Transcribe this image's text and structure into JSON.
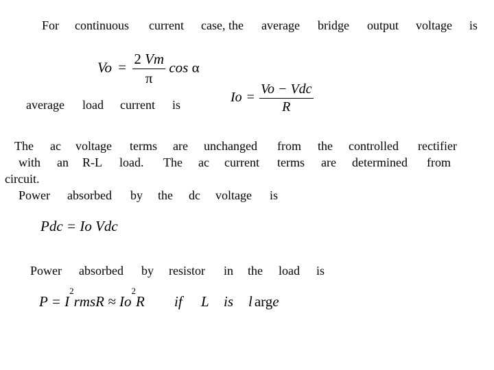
{
  "slide": {
    "line1": {
      "words": [
        "For",
        "continuous",
        "current",
        "case, the",
        "average",
        "bridge",
        "output",
        "voltage",
        "is"
      ]
    },
    "eq_vo": {
      "lhs": "Vo",
      "equals": "=",
      "numerator": "2 Vm",
      "denominator": "π",
      "trail": "cos",
      "alpha": "α"
    },
    "line2": {
      "words": [
        "average",
        "load",
        "current",
        "is"
      ]
    },
    "eq_io": {
      "lhs": "Io",
      "equals": "=",
      "numerator": "Vo − Vdc",
      "denominator": "R"
    },
    "para": {
      "line_a": [
        "The",
        "ac",
        "voltage",
        "terms",
        "are",
        "unchanged",
        "from",
        "the",
        "controlled",
        "rectifier"
      ],
      "line_b": [
        "with",
        "an",
        "R-L",
        "load.",
        "The",
        "ac",
        "current",
        "terms",
        "are",
        "determined",
        "from"
      ],
      "line_c": "circuit.",
      "line_d": [
        "Power",
        "absorbed",
        "by",
        "the",
        "dc",
        "voltage",
        "is"
      ]
    },
    "eq_pdc": {
      "text": "Pdc = Io Vdc"
    },
    "line3": {
      "words": [
        "Power",
        "absorbed",
        "by",
        "resistor",
        "in",
        "the",
        "load",
        "is"
      ]
    },
    "eq_p": {
      "p": "P = I",
      "sq1": "2",
      "mid": "rmsR ≈ Io",
      "sq2": "2",
      "r": "R",
      "if": "if",
      "l": "L",
      "is": "is",
      "large_l": "l",
      "large_arg": "arg",
      "large_e": "e"
    }
  }
}
